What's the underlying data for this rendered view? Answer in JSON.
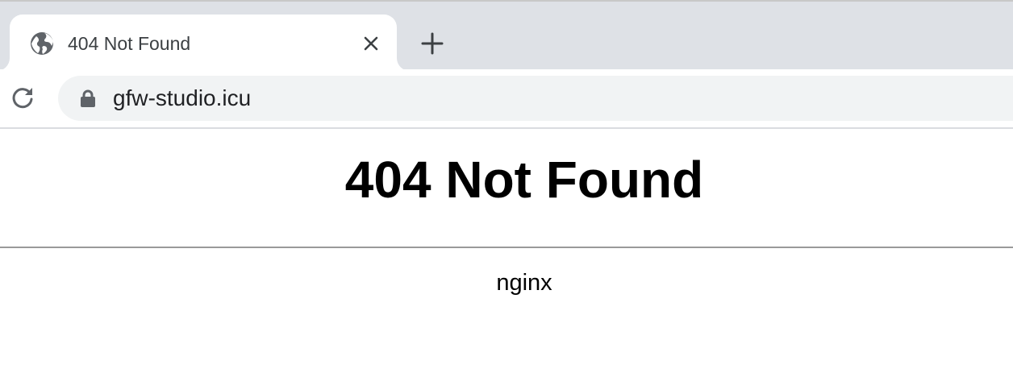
{
  "browser": {
    "tab": {
      "title": "404 Not Found",
      "favicon_icon": "globe-icon",
      "close_icon": "close-icon"
    },
    "new_tab_icon": "plus-icon",
    "toolbar": {
      "reload_icon": "reload-icon",
      "security_icon": "lock-icon",
      "url": "gfw-studio.icu"
    }
  },
  "page": {
    "heading": "404 Not Found",
    "server": "nginx"
  },
  "colors": {
    "tabstrip": "#dee1e6",
    "omnibox": "#f1f3f4",
    "icon": "#5f6368"
  }
}
